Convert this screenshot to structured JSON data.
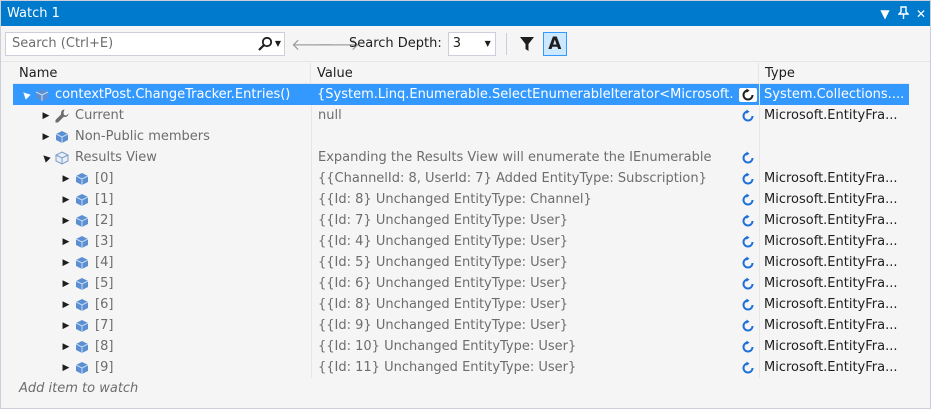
{
  "window": {
    "title": "Watch 1"
  },
  "toolbar": {
    "search_placeholder": "Search (Ctrl+E)",
    "search_depth_label": "Search Depth:",
    "search_depth_value": "3",
    "a_label": "A"
  },
  "columns": {
    "name": "Name",
    "value": "Value",
    "type": "Type"
  },
  "rows": [
    {
      "name": "contextPost.ChangeTracker.Entries()",
      "value": "{System.Linq.Enumerable.SelectEnumerableIterator<Microsoft.",
      "type": "System.Collections....",
      "indent": 0,
      "expander": "▲",
      "icon": "cube",
      "selected": true,
      "refresh": "stale"
    },
    {
      "name": "Current",
      "value": "null",
      "type": "Microsoft.EntityFra...",
      "indent": 1,
      "expander": "▶",
      "icon": "wrench",
      "dim_name": true,
      "dim_value": true,
      "refresh": "normal"
    },
    {
      "name": "Non-Public members",
      "value": "",
      "type": "",
      "indent": 1,
      "expander": "▶",
      "icon": "cube",
      "dim_name": true,
      "refresh": "none"
    },
    {
      "name": "Results View",
      "value": "Expanding the Results View will enumerate the IEnumerable",
      "type": "",
      "indent": 1,
      "expander": "▲",
      "icon": "cube-outline",
      "dim_name": true,
      "dim_value": true,
      "refresh": "normal"
    },
    {
      "name": "[0]",
      "value": "{{ChannelId: 8, UserId: 7} Added EntityType: Subscription}",
      "type": "Microsoft.EntityFra...",
      "indent": 2,
      "expander": "▶",
      "icon": "cube",
      "dim_name": true,
      "dim_value": true,
      "refresh": "normal"
    },
    {
      "name": "[1]",
      "value": "{{Id: 8} Unchanged EntityType: Channel}",
      "type": "Microsoft.EntityFra...",
      "indent": 2,
      "expander": "▶",
      "icon": "cube",
      "dim_name": true,
      "dim_value": true,
      "refresh": "normal"
    },
    {
      "name": "[2]",
      "value": "{{Id: 7} Unchanged EntityType: User}",
      "type": "Microsoft.EntityFra...",
      "indent": 2,
      "expander": "▶",
      "icon": "cube",
      "dim_name": true,
      "dim_value": true,
      "refresh": "normal"
    },
    {
      "name": "[3]",
      "value": "{{Id: 4} Unchanged EntityType: User}",
      "type": "Microsoft.EntityFra...",
      "indent": 2,
      "expander": "▶",
      "icon": "cube",
      "dim_name": true,
      "dim_value": true,
      "refresh": "normal"
    },
    {
      "name": "[4]",
      "value": "{{Id: 5} Unchanged EntityType: User}",
      "type": "Microsoft.EntityFra...",
      "indent": 2,
      "expander": "▶",
      "icon": "cube",
      "dim_name": true,
      "dim_value": true,
      "refresh": "normal"
    },
    {
      "name": "[5]",
      "value": "{{Id: 6} Unchanged EntityType: User}",
      "type": "Microsoft.EntityFra...",
      "indent": 2,
      "expander": "▶",
      "icon": "cube",
      "dim_name": true,
      "dim_value": true,
      "refresh": "normal"
    },
    {
      "name": "[6]",
      "value": "{{Id: 8} Unchanged EntityType: User}",
      "type": "Microsoft.EntityFra...",
      "indent": 2,
      "expander": "▶",
      "icon": "cube",
      "dim_name": true,
      "dim_value": true,
      "refresh": "normal"
    },
    {
      "name": "[7]",
      "value": "{{Id: 9} Unchanged EntityType: User}",
      "type": "Microsoft.EntityFra...",
      "indent": 2,
      "expander": "▶",
      "icon": "cube",
      "dim_name": true,
      "dim_value": true,
      "refresh": "normal"
    },
    {
      "name": "[8]",
      "value": "{{Id: 10} Unchanged EntityType: User}",
      "type": "Microsoft.EntityFra...",
      "indent": 2,
      "expander": "▶",
      "icon": "cube",
      "dim_name": true,
      "dim_value": true,
      "refresh": "normal"
    },
    {
      "name": "[9]",
      "value": "{{Id: 11} Unchanged EntityType: User}",
      "type": "Microsoft.EntityFra...",
      "indent": 2,
      "expander": "▶",
      "icon": "cube",
      "dim_name": true,
      "dim_value": true,
      "refresh": "normal"
    }
  ],
  "add_item_placeholder": "Add item to watch",
  "colors": {
    "titlebar": "#007acc",
    "selection": "#3399ff",
    "refresh_icon": "#1e6fd9",
    "cube_icon": "#5b8fd1"
  }
}
